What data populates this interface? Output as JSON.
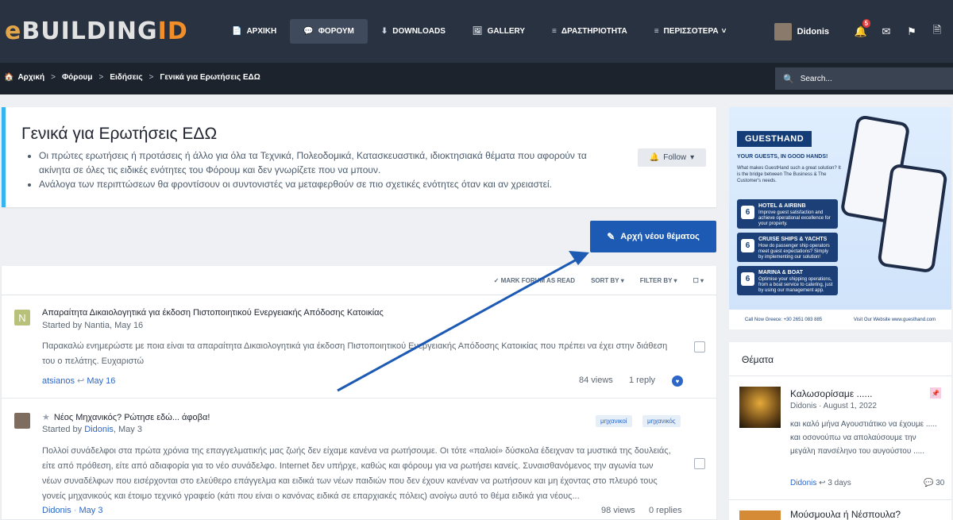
{
  "logo": {
    "e": "e",
    "building": "BUILDING",
    "id": "ID"
  },
  "nav": [
    {
      "label": "ΑΡΧΙΚΗ",
      "icon": "📄"
    },
    {
      "label": "ΦΟΡΟΥΜ",
      "icon": "💬"
    },
    {
      "label": "DOWNLOADS",
      "icon": "⬇"
    },
    {
      "label": "GALLERY",
      "icon": "🖼"
    },
    {
      "label": "ΔΡΑΣΤΗΡΙΟΤΗΤΑ",
      "icon": "≡"
    },
    {
      "label": "ΠΕΡΙΣΣΟΤΕΡΑ",
      "icon": "≡"
    }
  ],
  "nav_more_caret": "˅",
  "user": {
    "name": "Didonis",
    "alerts": "5"
  },
  "breadcrumb": {
    "home": "Αρχική",
    "forum": "Φόρουμ",
    "news": "Ειδήσεις",
    "current": "Γενικά για Ερωτήσεις ΕΔΩ",
    "sep": ">"
  },
  "search": {
    "label": "Search..."
  },
  "header": {
    "title": "Γενικά για Ερωτήσεις ΕΔΩ",
    "desc1": "Οι πρώτες ερωτήσεις ή προτάσεις ή άλλο για όλα τα Τεχνικά, Πολεοδομικά, Κατασκευαστικά, ιδιοκτησιακά θέματα που αφορούν τα ακίνητα σε όλες τις ειδικές ενότητες του Φόρουμ και δεν γνωρίζετε που να μπουν.",
    "desc2": "Ανάλογα των περιπτώσεων θα φροντίσουν οι συντονιστές να μεταφερθούν σε πιο σχετικές ενότητες όταν και αν χρειαστεί.",
    "follow": "Follow"
  },
  "new_thread": "Αρχή νέου θέματος",
  "filters": {
    "mark": "MARK FORUM AS READ",
    "sort": "SORT BY",
    "filter": "FILTER BY"
  },
  "threads": [
    {
      "avatar_letter": "N",
      "title": "Απαραίτητα Δικαιολογητικά για έκδοση Πιστοποιητικού Ενεργειακής Απόδοσης Κατοικίας",
      "started_by": "Started by Nantia, May 16",
      "excerpt": "Παρακαλώ ενημερώστε με ποια είναι τα απαραίτητα Δικαιολογητικά για έκδοση Πιστοποιητικού Ενεργειακής Απόδοσης Κατοικίας που πρέπει να έχει στην διάθεση του ο πελάτης. Ευχαριστώ",
      "last_user": "atsianos",
      "last_date": "May 16",
      "views": "84 views",
      "replies": "1 reply"
    },
    {
      "title": "Νέος Μηχανικός? Ρώτησε εδώ... άφοβα!",
      "started_prefix": "Started by",
      "started_user": "Didonis",
      "started_date": ", May 3",
      "tags": [
        "μηχανικοί",
        "μηχανικός"
      ],
      "excerpt": "Πολλοί συνάδελφοι στα πρώτα χρόνια της επαγγελματικής μας ζωής δεν είχαμε κανένα να ρωτήσουμε. Οι τότε «παλιοί» δύσκολα έδειχναν τα μυστικά της δουλειάς, είτε από πρόθεση, είτε από αδιαφορία για το νέο συνάδελφο. Internet δεν υπήρχε, καθώς και φόρουμ για να ρωτήσει κανείς. Συναισθανόμενος την αγωνία των νέων συναδέλφων που εισέρχονται στο ελεύθερο επάγγελμα και ειδικά των νέων παιδιών που δεν έχουν κανέναν να ρωτήσουν και μη έχοντας στο πλευρό τους γονείς μηχανικούς και έτοιμο τεχνικό γραφείο (κάτι που είναι ο κανόνας ειδικά σε επαρχιακές πόλεις) ανοίγω αυτό το θέμα ειδικά για νέους...",
      "last_user": "Didonis",
      "last_date": "May 3",
      "views": "98 views",
      "replies": "0 replies"
    }
  ],
  "ad": {
    "brand": "GUESTHAND",
    "tagline": "YOUR GUESTS, IN GOOD HANDS!",
    "blurb": "What makes GuestHand such a great solution? It is the bridge between The Business & The Customer's needs.",
    "boxes": [
      {
        "title": "HOTEL & AIRBNB",
        "text": "Improve guest satisfaction and achieve operational excellence for your property."
      },
      {
        "title": "CRUISE SHIPS & YACHTS",
        "text": "How do passenger ship operators meet guest expectations? Simply by implementing our solution!"
      },
      {
        "title": "MARINA & BOAT",
        "text": "Optimise your shipping operations, from a boat service to catering, just by using our management app."
      }
    ],
    "call": "Call Now Greece: +30 2651 083 885",
    "visit": "Visit Our Website www.guesthand.com"
  },
  "sidebar": {
    "title": "Θέματα",
    "item": {
      "title": "Καλωσορίσαμε ......",
      "meta": "Didonis · August 1, 2022",
      "text": "και καλό μήνα Αγουστιάτικο να έχουμε ..... και οσονούπω να απολαύσουμε την μεγάλη πανσέληνο του αυγούστου .....",
      "foot_user": "Didonis",
      "foot_time": "3 days",
      "count": "30"
    },
    "next_title": "Μούσμουλα ή Νέσπουλα?"
  },
  "colors": {
    "accent": "#1d5ab4",
    "topbar": "#293241",
    "highlight": "#35b4f0"
  }
}
